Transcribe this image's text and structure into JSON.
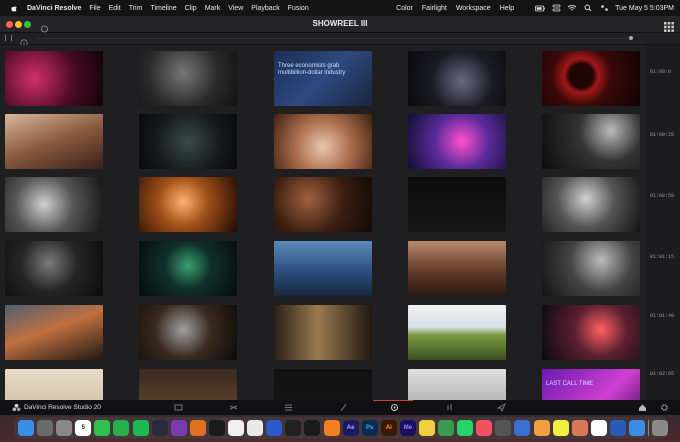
{
  "menubar": {
    "app_name": "DaVinci Resolve",
    "items": [
      "File",
      "Edit",
      "Trim",
      "Timeline",
      "Clip",
      "Mark",
      "View",
      "Playback",
      "Fusion",
      "Color",
      "Fairlight",
      "Workspace",
      "Help"
    ],
    "clock": "Tue May 5  5:03PM"
  },
  "window": {
    "title": "SHOWREEL III"
  },
  "timecodes": [
    "01:00:0",
    "01:00:25",
    "01:00:50",
    "01:01:15",
    "01:01:40",
    "01:02:05"
  ],
  "thumbnails": [
    {
      "style": "pink",
      "text": ""
    },
    {
      "style": "gray",
      "text": ""
    },
    {
      "style": "blue-text",
      "text": "Three economists grab multibillion-dollar industry"
    },
    {
      "style": "night",
      "text": ""
    },
    {
      "style": "red-ring",
      "text": ""
    },
    {
      "style": "warm-room",
      "text": ""
    },
    {
      "style": "dark-teal",
      "text": ""
    },
    {
      "style": "skin",
      "text": ""
    },
    {
      "style": "concert",
      "text": ""
    },
    {
      "style": "mono-dark",
      "text": ""
    },
    {
      "style": "mono",
      "text": ""
    },
    {
      "style": "orange",
      "text": ""
    },
    {
      "style": "amber-dark",
      "text": ""
    },
    {
      "style": "near-black",
      "text": ""
    },
    {
      "style": "mono-hand",
      "text": ""
    },
    {
      "style": "dark-car",
      "text": ""
    },
    {
      "style": "green-dots",
      "text": ""
    },
    {
      "style": "blue-sky",
      "text": ""
    },
    {
      "style": "bar-warm",
      "text": ""
    },
    {
      "style": "street",
      "text": ""
    },
    {
      "style": "city",
      "text": ""
    },
    {
      "style": "watch",
      "text": ""
    },
    {
      "style": "office",
      "text": ""
    },
    {
      "style": "field",
      "text": ""
    },
    {
      "style": "neon-night",
      "text": ""
    },
    {
      "style": "pale",
      "text": ""
    },
    {
      "style": "brown",
      "text": ""
    },
    {
      "style": "dark2",
      "text": ""
    },
    {
      "style": "bright",
      "text": ""
    },
    {
      "style": "purple",
      "text": "LAST CALL TIME"
    }
  ],
  "bottom": {
    "product_label": "DaVinci Resolve Studio 20"
  },
  "dock": {
    "icons": [
      "finder-icon",
      "launchpad-icon",
      "settings-icon",
      "calendar-icon",
      "messages-icon",
      "facetime-icon",
      "spotify-icon",
      "resolve-icon",
      "fusion-icon",
      "blender-icon",
      "capcut-icon",
      "photos-icon",
      "chrome-icon",
      "arc-icon",
      "terminal-icon",
      "figma-icon",
      "vlc-icon",
      "aftereffects-icon",
      "photoshop-icon",
      "illustrator-icon",
      "mediaencoder-icon",
      "notes-icon",
      "maps-icon",
      "whatsapp-icon",
      "music-icon",
      "calculator-icon",
      "keynote-icon",
      "pages-icon",
      "notes2-icon",
      "claude-icon",
      "notion-icon",
      "word-icon",
      "files-icon",
      "trash-icon"
    ],
    "calendar_day": "5",
    "labels": {
      "ae": "Ae",
      "ps": "Ps",
      "ai": "Ai",
      "me": "Me"
    }
  }
}
